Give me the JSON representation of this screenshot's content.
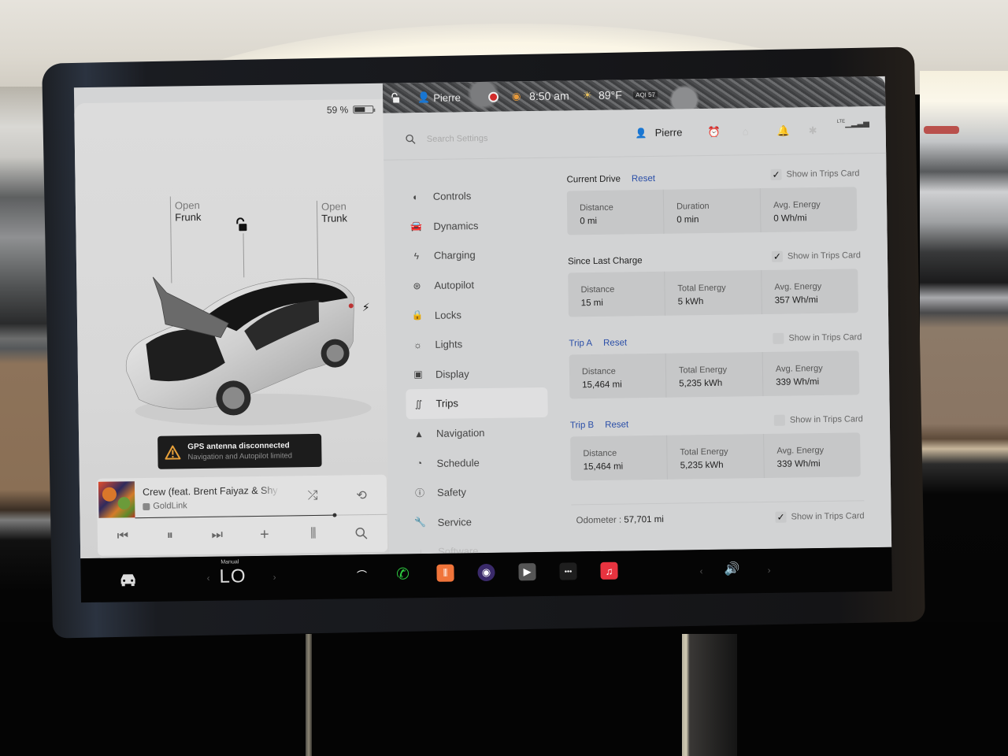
{
  "car_panel": {
    "battery_percent_text": "59 %",
    "battery_level": 0.59,
    "frunk": {
      "line1": "Open",
      "line2": "Frunk"
    },
    "trunk": {
      "line1": "Open",
      "line2": "Trunk"
    },
    "lock_state_icon": "unlocked-padlock-icon",
    "charge_port_icon": "lightning-bolt-icon",
    "alert": {
      "title": "GPS antenna disconnected",
      "subtitle": "Navigation and Autopilot limited",
      "icon": "warning-triangle-icon",
      "accent_color": "#e8a13a"
    }
  },
  "media": {
    "song_title": "Crew (feat. Brent Faiyaz & Shy Glizzy)",
    "artist": "GoldLink",
    "progress": 0.79,
    "controls": [
      "previous",
      "pause",
      "next",
      "add",
      "equalizer",
      "search"
    ],
    "shuffle_icon": "shuffle-icon",
    "repeat_icon": "repeat-icon"
  },
  "status_bar": {
    "profile_name": "Pierre",
    "time": "8:50 am",
    "temperature": "89°F",
    "aqi": "AQI 57",
    "record_color": "#d12b2b"
  },
  "settings_header": {
    "search_placeholder": "Search Settings",
    "profile_name": "Pierre",
    "icons": [
      "alarm-clock-icon",
      "homelink-icon",
      "notification-bell-icon",
      "bluetooth-icon",
      "lte-signal-icon"
    ],
    "lte_label": "LTE"
  },
  "nav": {
    "items": [
      {
        "label": "Controls",
        "icon": "toggle-icon"
      },
      {
        "label": "Dynamics",
        "icon": "car-front-icon"
      },
      {
        "label": "Charging",
        "icon": "lightning-icon"
      },
      {
        "label": "Autopilot",
        "icon": "steering-wheel-icon"
      },
      {
        "label": "Locks",
        "icon": "lock-icon"
      },
      {
        "label": "Lights",
        "icon": "sun-icon"
      },
      {
        "label": "Display",
        "icon": "display-icon"
      },
      {
        "label": "Trips",
        "icon": "trips-icon",
        "active": true
      },
      {
        "label": "Navigation",
        "icon": "navigation-arrow-icon"
      },
      {
        "label": "Schedule",
        "icon": "alarm-icon"
      },
      {
        "label": "Safety",
        "icon": "safety-icon"
      },
      {
        "label": "Service",
        "icon": "wrench-icon"
      },
      {
        "label": "Software",
        "icon": "download-icon"
      }
    ]
  },
  "trips": {
    "show_label": "Show in Trips Card",
    "reset_label": "Reset",
    "sections": [
      {
        "title": "Current Drive",
        "has_reset": true,
        "title_link": false,
        "show_in_card": true,
        "cells": [
          {
            "label": "Distance",
            "value": "0 mi"
          },
          {
            "label": "Duration",
            "value": "0 min"
          },
          {
            "label": "Avg. Energy",
            "value": "0 Wh/mi"
          }
        ]
      },
      {
        "title": "Since Last Charge",
        "has_reset": false,
        "title_link": false,
        "show_in_card": true,
        "cells": [
          {
            "label": "Distance",
            "value": "15 mi"
          },
          {
            "label": "Total Energy",
            "value": "5 kWh"
          },
          {
            "label": "Avg. Energy",
            "value": "357 Wh/mi"
          }
        ]
      },
      {
        "title": "Trip A",
        "has_reset": true,
        "title_link": true,
        "show_in_card": false,
        "cells": [
          {
            "label": "Distance",
            "value": "15,464 mi"
          },
          {
            "label": "Total Energy",
            "value": "5,235 kWh"
          },
          {
            "label": "Avg. Energy",
            "value": "339 Wh/mi"
          }
        ]
      },
      {
        "title": "Trip B",
        "has_reset": true,
        "title_link": true,
        "show_in_card": false,
        "cells": [
          {
            "label": "Distance",
            "value": "15,464 mi"
          },
          {
            "label": "Total Energy",
            "value": "5,235 kWh"
          },
          {
            "label": "Avg. Energy",
            "value": "339 Wh/mi"
          }
        ]
      }
    ],
    "odometer": {
      "label": "Odometer :",
      "value": "57,701 mi",
      "show_in_card": true
    }
  },
  "taskbar": {
    "climate_mode": "Manual",
    "climate_temp": "LO",
    "apps": [
      {
        "name": "wiper-icon",
        "color": "#00000000"
      },
      {
        "name": "phone-icon",
        "color": "#00000000",
        "glyph_color": "#2ecc40"
      },
      {
        "name": "voice-recorder-icon",
        "color": "#f0743a"
      },
      {
        "name": "camera-icon",
        "color": "#3a2a6a"
      },
      {
        "name": "theater-icon",
        "color": "#555555"
      },
      {
        "name": "more-apps-icon",
        "color": "#1e1e1e"
      },
      {
        "name": "music-icon",
        "color": "#e8333f"
      }
    ],
    "volume_icon": "speaker-volume-icon"
  }
}
